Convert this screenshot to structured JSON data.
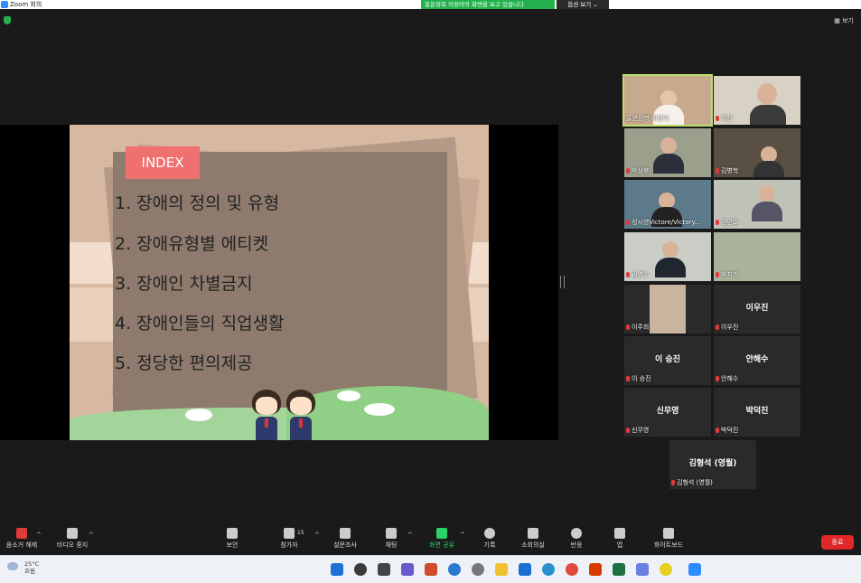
{
  "window": {
    "title": "Zoom 회의"
  },
  "share_banner": {
    "text": "홍문정복 이정아의 화면을 보고 있습니다",
    "view_options": "옵션 보기 ⌄"
  },
  "view_button": "보기",
  "slide": {
    "index_label": "INDEX",
    "items": [
      "1.  장애의 정의 및 유형",
      "2.  장애유형별 에티켓",
      "3.  장애인 차별금지",
      "4.  장애인들의 직업생활",
      "5.  정당한 편의제공"
    ]
  },
  "participants": [
    {
      "name": "홍문정복 이정아",
      "mic": false,
      "video": true
    },
    {
      "name": "회장",
      "mic": true,
      "video": true
    },
    {
      "name": "박상후",
      "mic": true,
      "video": true
    },
    {
      "name": "김병학",
      "mic": true,
      "video": true
    },
    {
      "name": "성시영Victore/Victory...",
      "mic": true,
      "video": true
    },
    {
      "name": "김민호",
      "mic": true,
      "video": true
    },
    {
      "name": "김영수",
      "mic": true,
      "video": true
    },
    {
      "name": "박지희",
      "mic": true,
      "video": true
    },
    {
      "name": "이주희",
      "mic": true,
      "video": true
    },
    {
      "name": "이우진",
      "center": "이우진",
      "mic": true,
      "video": false
    },
    {
      "name": "이 승진",
      "center": "이 승진",
      "mic": true,
      "video": false
    },
    {
      "name": "안해수",
      "center": "안해수",
      "mic": true,
      "video": false
    },
    {
      "name": "신무영",
      "center": "신무영",
      "mic": true,
      "video": false
    },
    {
      "name": "박덕진",
      "center": "박덕진",
      "mic": true,
      "video": false
    },
    {
      "name": "김형석 (영월)",
      "center": "김형석 (영월)",
      "mic": true,
      "video": false
    }
  ],
  "toolbar": {
    "mute": "음소거 해제",
    "video": "비디오 중지",
    "security": "보안",
    "participants": "참가자",
    "participant_count": "15",
    "polls": "설문조사",
    "chat": "채팅",
    "share": "화면 공유",
    "record": "기록",
    "breakout": "소회의실",
    "reactions": "반응",
    "apps": "앱",
    "whiteboard": "화이트보드",
    "end": "종료"
  },
  "taskbar": {
    "temperature": "25°C",
    "weather": "흐림"
  },
  "colors": {
    "share_green": "#23b14d",
    "active_speaker": "#b9e06a",
    "end_red": "#e02828",
    "index_pink": "#f07070"
  }
}
